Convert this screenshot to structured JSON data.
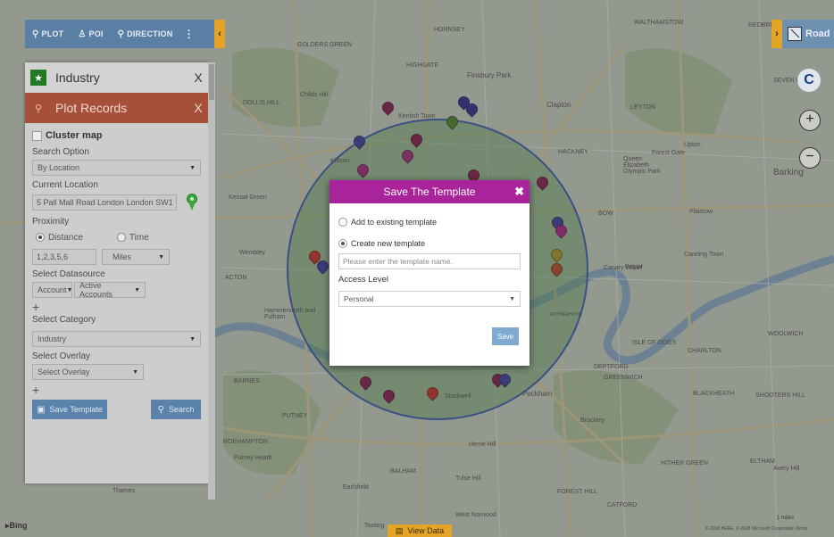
{
  "toolbar": {
    "plot_label": "PLOT",
    "poi_label": "POI",
    "direction_label": "DIRECTION",
    "kebab": "⋮",
    "collapse_glyph": "‹"
  },
  "road_toggle": {
    "chevron": "›",
    "label": "Road"
  },
  "panel": {
    "industry_title": "Industry",
    "plot_title": "Plot Records",
    "close_glyph": "X",
    "cluster_map_label": "Cluster map",
    "search_option_label": "Search Option",
    "search_option_value": "By Location",
    "current_location_label": "Current Location",
    "current_location_value": "5 Pall Mall Road London London SW1Y",
    "proximity_label": "Proximity",
    "radio_distance": "Distance",
    "radio_time": "Time",
    "distance_value": "1,2,3,5,6",
    "units_value": "Miles",
    "select_datasource_label": "Select Datasource",
    "datasource_entity": "Account",
    "datasource_view": "Active Accounts",
    "plus_glyph": "+",
    "select_category_label": "Select Category",
    "category_value": "Industry",
    "select_overlay_label": "Select Overlay",
    "overlay_value": "Select Overlay",
    "save_template_button": "Save Template",
    "search_button": "Search"
  },
  "modal": {
    "title": "Save The Template",
    "close_glyph": "✖",
    "option_existing": "Add to existing template",
    "option_new": "Create new template",
    "template_name_placeholder": "Please enter the template name.",
    "access_level_label": "Access Level",
    "access_level_value": "Personal",
    "save_button": "Save"
  },
  "map_controls": {
    "compass_glyph": "C",
    "zoom_in": "+",
    "zoom_out": "−"
  },
  "bottom": {
    "bing": "Bing",
    "view_data": "View Data",
    "copyright": "© 2018 HERE, © 2018 Microsoft Corporation  Terms",
    "scale": "1 miles"
  },
  "map_labels": [
    "GOLDERS GREEN",
    "HIGHGATE",
    "HORNSEY",
    "Finsbury Park",
    "Childs Hill",
    "Kentish Town",
    "Clapton",
    "LEYTON",
    "Kilburn",
    "HACKNEY",
    "Queen Elizabeth Olympic Park",
    "Upton",
    "Barking",
    "Kensal Green",
    "Plaistow",
    "Canning Town",
    "Canary Wharf",
    "ROTHERHITHE",
    "Hammersmith and Fulham",
    "ACTON",
    "Wembley",
    "BARNES",
    "PUTNEY",
    "ROEHAMPTON",
    "Putney Heath",
    "Stockwell",
    "Peckham",
    "DEPTFORD",
    "Brockley",
    "Heme Hill",
    "Tulse Hill",
    "BALHAM",
    "Earlsfield",
    "West Norwood",
    "Tooting",
    "FOREST HILL",
    "CATFORD",
    "BLACKHEATH",
    "SHOOTERS HILL",
    "ELTHAM",
    "Avery Hill",
    "WOOLWICH",
    "CHARLTON",
    "ISLE OF DOGS",
    "HITHER GREEN",
    "GREENWICH",
    "DOLLIS HILL",
    "SEVEN KINGS",
    "REDBRIDGE",
    "WALTHAMSTOW",
    "Forest Gate",
    "Poplar",
    "BOW",
    "Thames"
  ],
  "colors": {
    "toolbar_bg": "#5a7fa4",
    "accent_orange": "#e4a426",
    "plot_header": "#a6503a",
    "industry_badge": "#227a27",
    "modal_header": "#a9239a",
    "save_button": "#7fa9cf",
    "radius_fill": "#5aa55a"
  }
}
